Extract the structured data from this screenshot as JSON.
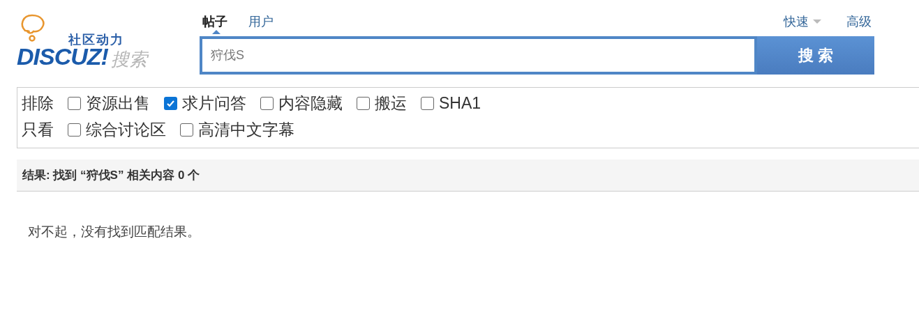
{
  "logo": {
    "slogan": "社区动力",
    "brand": "DISCUZ!",
    "suffix": "搜索"
  },
  "tabs": [
    {
      "label": "帖子",
      "selected": true
    },
    {
      "label": "用户",
      "selected": false
    }
  ],
  "links": [
    {
      "label": "快速",
      "dropdown": true
    },
    {
      "label": "高级",
      "dropdown": false
    }
  ],
  "search": {
    "value": "狩伐S",
    "button": "搜 索"
  },
  "filters": [
    {
      "label": "排除",
      "options": [
        {
          "label": "资源出售",
          "checked": false
        },
        {
          "label": "求片问答",
          "checked": true
        },
        {
          "label": "内容隐藏",
          "checked": false
        },
        {
          "label": "搬运",
          "checked": false
        },
        {
          "label": "SHA1",
          "checked": false
        }
      ]
    },
    {
      "label": "只看",
      "options": [
        {
          "label": "综合讨论区",
          "checked": false
        },
        {
          "label": "高清中文字幕",
          "checked": false
        }
      ]
    }
  ],
  "result_header": "结果: 找到 “狩伐S” 相关内容 0 个",
  "message": "对不起，没有找到匹配结果。"
}
